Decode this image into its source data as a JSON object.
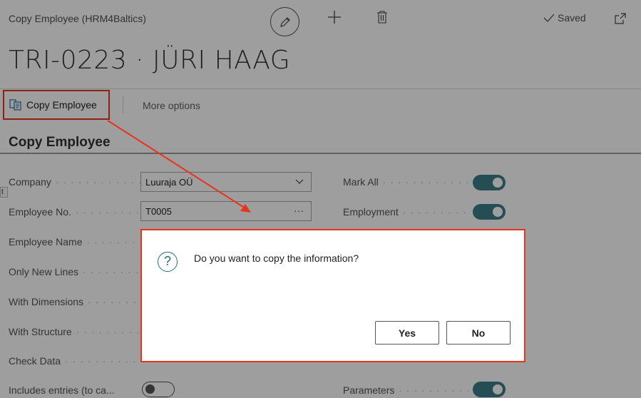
{
  "header": {
    "page_caption": "Copy Employee (HRM4Baltics)",
    "saved_label": "Saved",
    "record_title": "TRI-0223 · JÜRI HAAG"
  },
  "actions": {
    "copy_employee": "Copy Employee",
    "more_options": "More options"
  },
  "section": {
    "title": "Copy Employee"
  },
  "fields_left": [
    {
      "label": "Company",
      "value": "Luuraja OÜ"
    },
    {
      "label": "Employee No.",
      "value": "T0005"
    },
    {
      "label": "Employee Name"
    },
    {
      "label": "Only New Lines"
    },
    {
      "label": "With Dimensions"
    },
    {
      "label": "With Structure"
    },
    {
      "label": "Check Data"
    },
    {
      "label": "Includes entries (to ca...",
      "toggle": "off"
    }
  ],
  "fields_right": [
    {
      "label": "Mark All",
      "toggle": "on"
    },
    {
      "label": "Employment",
      "toggle": "on"
    },
    {
      "label": "Parameters",
      "toggle": "on"
    }
  ],
  "tooltip_stub": "t",
  "dialog": {
    "icon": "question-icon",
    "message": "Do you want to copy the information?",
    "yes_label": "Yes",
    "no_label": "No"
  },
  "colors": {
    "accent": "#3a7f87",
    "highlight": "#e8341c",
    "icon": "#1f6f74"
  }
}
